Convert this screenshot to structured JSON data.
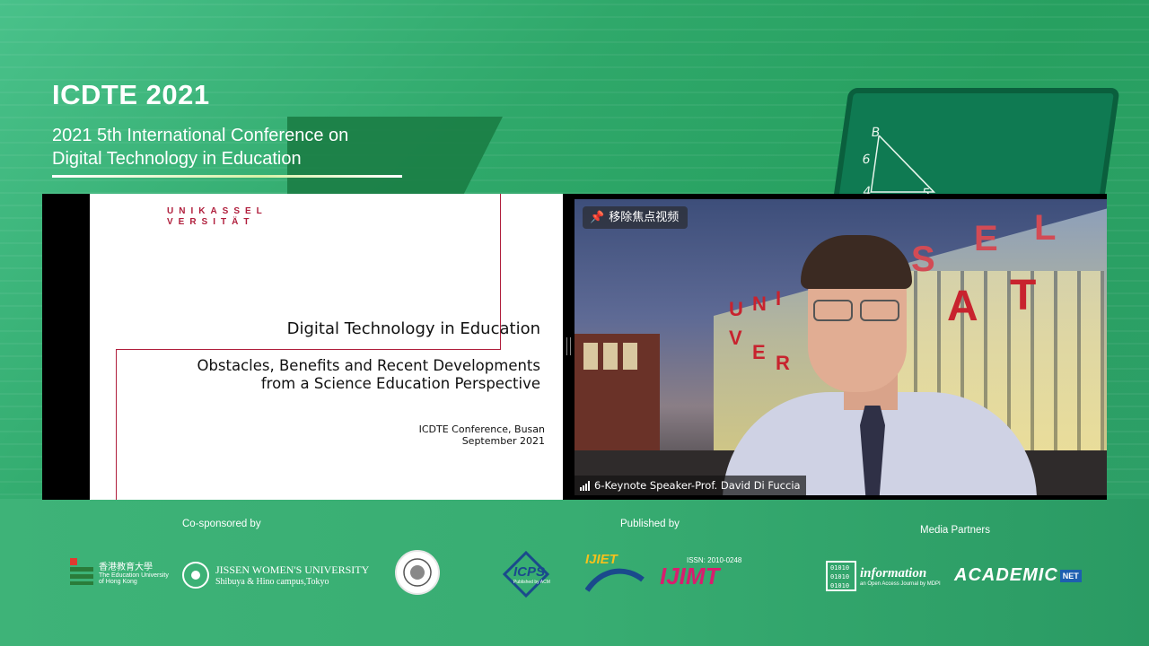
{
  "header": {
    "title": "ICDTE 2021",
    "subtitle_line1": "2021 5th International Conference on",
    "subtitle_line2": "Digital Technology in Education"
  },
  "slide": {
    "logo_line1": "UNIKASSEL",
    "logo_line2": "VERSITÄT",
    "title": "Digital Technology in Education",
    "subtitle_line1": "Obstacles, Benefits and Recent Developments",
    "subtitle_line2": "from a Science Education Perspective",
    "event_line1": "ICDTE Conference, Busan",
    "event_line2": "September 2021"
  },
  "video": {
    "pin_label": "移除焦点视频",
    "speaker_name": "6-Keynote Speaker-Prof. David Di Fuccia",
    "signal_level": 4,
    "building_letters": [
      "S",
      "E",
      "L",
      "A",
      "T",
      "U",
      "N",
      "I",
      "V",
      "E",
      "R"
    ]
  },
  "board": {
    "labels": [
      "B",
      "6",
      "4",
      "5"
    ]
  },
  "footer": {
    "cosponsored_label": "Co-sponsored by",
    "published_label": "Published by",
    "media_label": "Media Partners",
    "hku_cn": "香港教育大學",
    "hku_en1": "The Education University",
    "hku_en2": "of Hong Kong",
    "jissen_title": "JISSEN WOMEN'S UNIVERSITY",
    "jissen_sub": "Shibuya & Hino campus,Tokyo",
    "icps": "ICPS",
    "icps_sub": "Published by ACM",
    "ijiet": "IJIET",
    "ijimt_issn": "ISSN: 2010-0248",
    "ijimt": "IJIMT",
    "information": "information",
    "information_sub": "an Open Access Journal by MDPI",
    "binary": [
      "01010",
      "01010",
      "01010"
    ],
    "academic": "ACADEMIC",
    "academic_net": "NET"
  },
  "colors": {
    "brand_green": "#2fa86a",
    "kassel_red": "#b01e3c"
  }
}
